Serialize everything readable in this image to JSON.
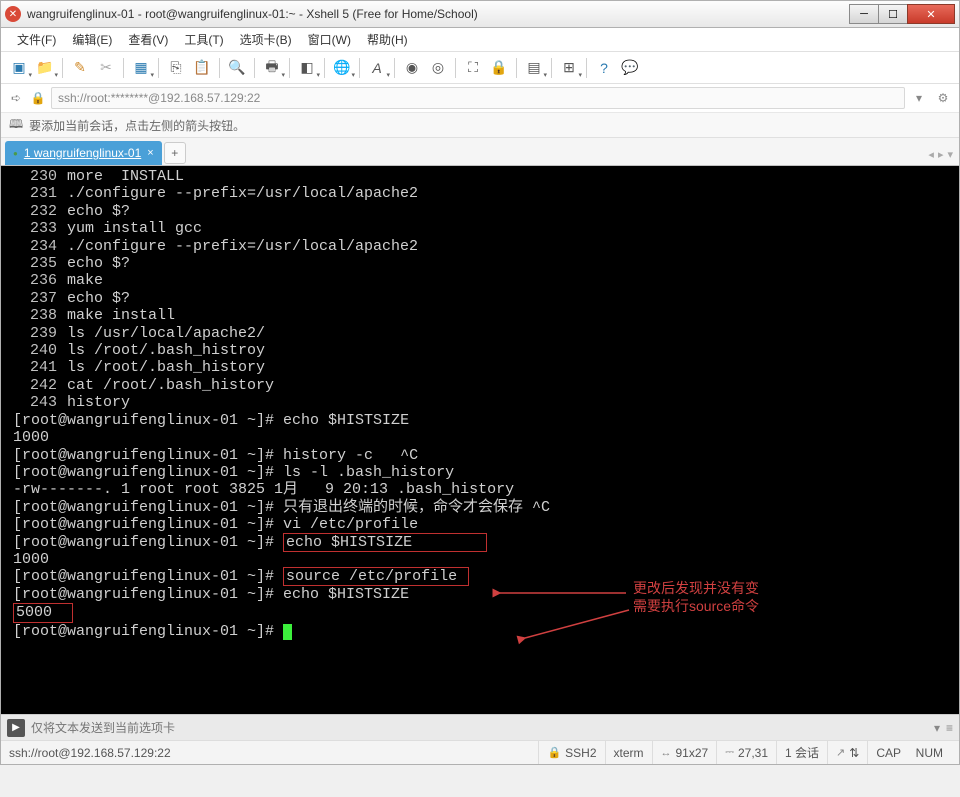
{
  "title": "wangruifenglinux-01 - root@wangruifenglinux-01:~ - Xshell 5 (Free for Home/School)",
  "menu": [
    "文件(F)",
    "编辑(E)",
    "查看(V)",
    "工具(T)",
    "选项卡(B)",
    "窗口(W)",
    "帮助(H)"
  ],
  "address": "ssh://root:********@192.168.57.129:22",
  "hint": "要添加当前会话，点击左侧的箭头按钮。",
  "tab": {
    "label": "1 wangruifenglinux-01"
  },
  "history": [
    {
      "n": "230",
      "t": "more  INSTALL"
    },
    {
      "n": "231",
      "t": "./configure --prefix=/usr/local/apache2"
    },
    {
      "n": "232",
      "t": "echo $?"
    },
    {
      "n": "233",
      "t": "yum install gcc"
    },
    {
      "n": "234",
      "t": "./configure --prefix=/usr/local/apache2"
    },
    {
      "n": "235",
      "t": "echo $?"
    },
    {
      "n": "236",
      "t": "make"
    },
    {
      "n": "237",
      "t": "echo $?"
    },
    {
      "n": "238",
      "t": "make install"
    },
    {
      "n": "239",
      "t": "ls /usr/local/apache2/"
    },
    {
      "n": "240",
      "t": "ls /root/.bash_histroy"
    },
    {
      "n": "241",
      "t": "ls /root/.bash_history"
    },
    {
      "n": "242",
      "t": "cat /root/.bash_history"
    },
    {
      "n": "243",
      "t": "history"
    }
  ],
  "prompt": "[root@wangruifenglinux-01 ~]#",
  "cmds": {
    "echo1": "echo $HISTSIZE",
    "out1": "1000",
    "histc": "history -c   ^C",
    "lsl": "ls -l .bash_history",
    "lsout": "-rw-------. 1 root root 3825 1月   9 20:13 .bash_history",
    "cn1": "只有退出终端的时候，命令才会保存 ^C",
    "vi": "vi /etc/profile",
    "echo2": "echo $HISTSIZE",
    "out2": "1000",
    "source": "source /etc/profile",
    "echo3": "echo $HISTSIZE",
    "out3": "5000"
  },
  "annot": {
    "l1": "更改后发现并没有变",
    "l2": "需要执行source命令"
  },
  "send_placeholder": "仅将文本发送到当前选项卡",
  "status": {
    "conn": "ssh://root@192.168.57.129:22",
    "s1": "SSH2",
    "s2": "xterm",
    "s3": "91x27",
    "s4": "27,31",
    "s5": "1 会话",
    "s6": "CAP",
    "s7": "NUM"
  }
}
